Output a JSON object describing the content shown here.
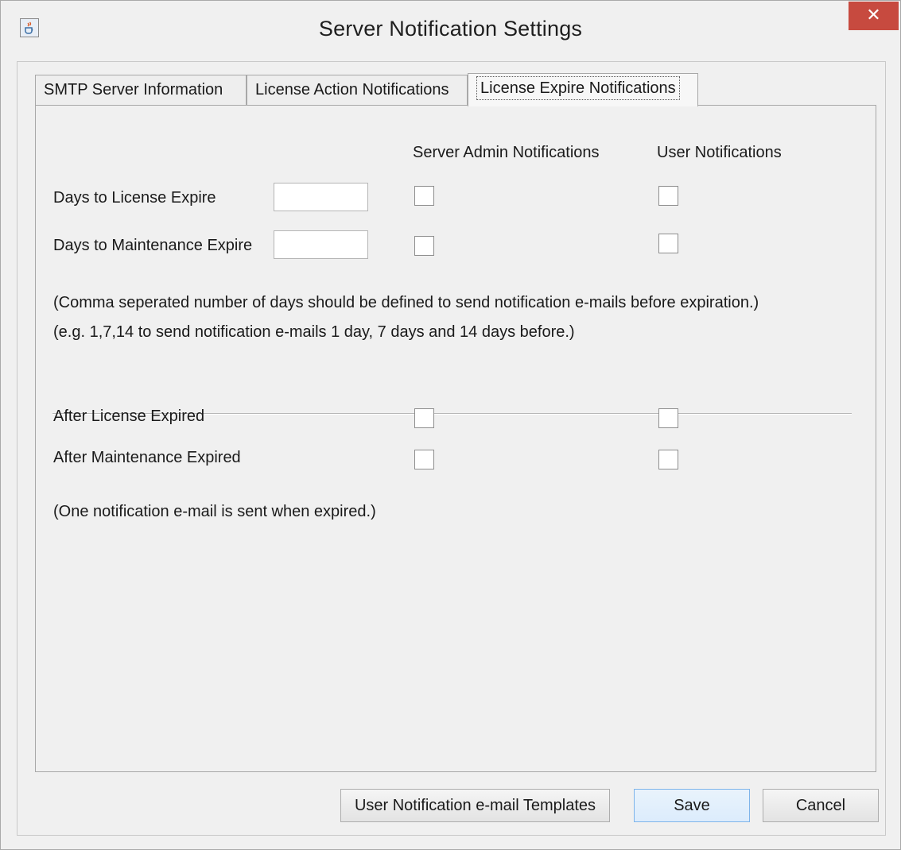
{
  "window": {
    "title": "Server Notification Settings",
    "close_label": "✕"
  },
  "tabs": [
    {
      "label": "SMTP Server Information",
      "active": false
    },
    {
      "label": "License Action Notifications",
      "active": false
    },
    {
      "label": "License Expire Notifications",
      "active": true
    }
  ],
  "panel": {
    "col_admin": "Server Admin Notifications",
    "col_user": "User Notifications",
    "rows_days": [
      {
        "label": "Days to License Expire",
        "value": "",
        "admin_checked": false,
        "user_checked": false
      },
      {
        "label": "Days to Maintenance Expire",
        "value": "",
        "admin_checked": false,
        "user_checked": false
      }
    ],
    "note_line1": "(Comma seperated number of days should be defined to send notification e-mails before expiration.)",
    "note_line2": "(e.g. 1,7,14 to send notification e-mails 1 day, 7 days and 14 days before.)",
    "rows_after": [
      {
        "label": "After License Expired",
        "admin_checked": false,
        "user_checked": false
      },
      {
        "label": "After Maintenance Expired",
        "admin_checked": false,
        "user_checked": false
      }
    ],
    "note_expired": "(One notification e-mail is sent when expired.)"
  },
  "footer": {
    "templates_label": "User Notification e-mail Templates",
    "save_label": "Save",
    "cancel_label": "Cancel"
  },
  "colors": {
    "close_button": "#c74a3f",
    "primary_button_border": "#7eb4ea",
    "window_background": "#f0f0f0"
  },
  "icons": {
    "app_icon": "java-cup-icon"
  }
}
